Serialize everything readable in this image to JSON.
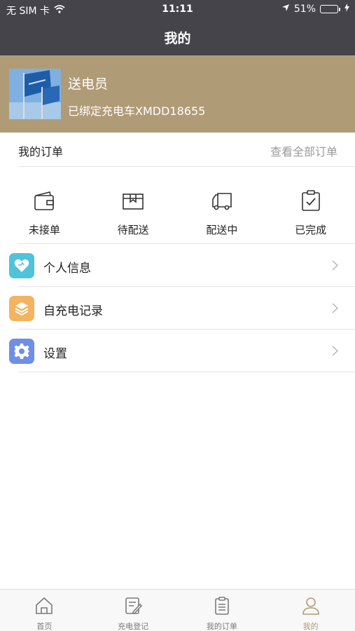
{
  "status_bar": {
    "carrier": "无 SIM 卡",
    "time": "11:11",
    "battery": "51%",
    "battery_level": 0.51
  },
  "nav": {
    "title": "我的"
  },
  "profile": {
    "name": "送电员",
    "car": "已绑定充电车XMDD18655"
  },
  "orders": {
    "title": "我的订单",
    "view_all": "查看全部订单",
    "statuses": [
      {
        "label": "未接单",
        "icon": "wallet-icon"
      },
      {
        "label": "待配送",
        "icon": "package-icon"
      },
      {
        "label": "配送中",
        "icon": "truck-icon"
      },
      {
        "label": "已完成",
        "icon": "clipboard-check-icon"
      }
    ]
  },
  "menu": [
    {
      "label": "个人信息",
      "icon": "heart-icon",
      "color": "#4fc3d9"
    },
    {
      "label": "自充电记录",
      "icon": "layers-icon",
      "color": "#f4b35f"
    },
    {
      "label": "设置",
      "icon": "gear-icon",
      "color": "#6f8ee6"
    }
  ],
  "tabbar": {
    "active_color": "#b09b77",
    "items": [
      {
        "label": "首页",
        "icon": "home-icon"
      },
      {
        "label": "充电登记",
        "icon": "edit-icon"
      },
      {
        "label": "我的订单",
        "icon": "list-icon"
      },
      {
        "label": "我的",
        "icon": "user-icon"
      }
    ]
  }
}
